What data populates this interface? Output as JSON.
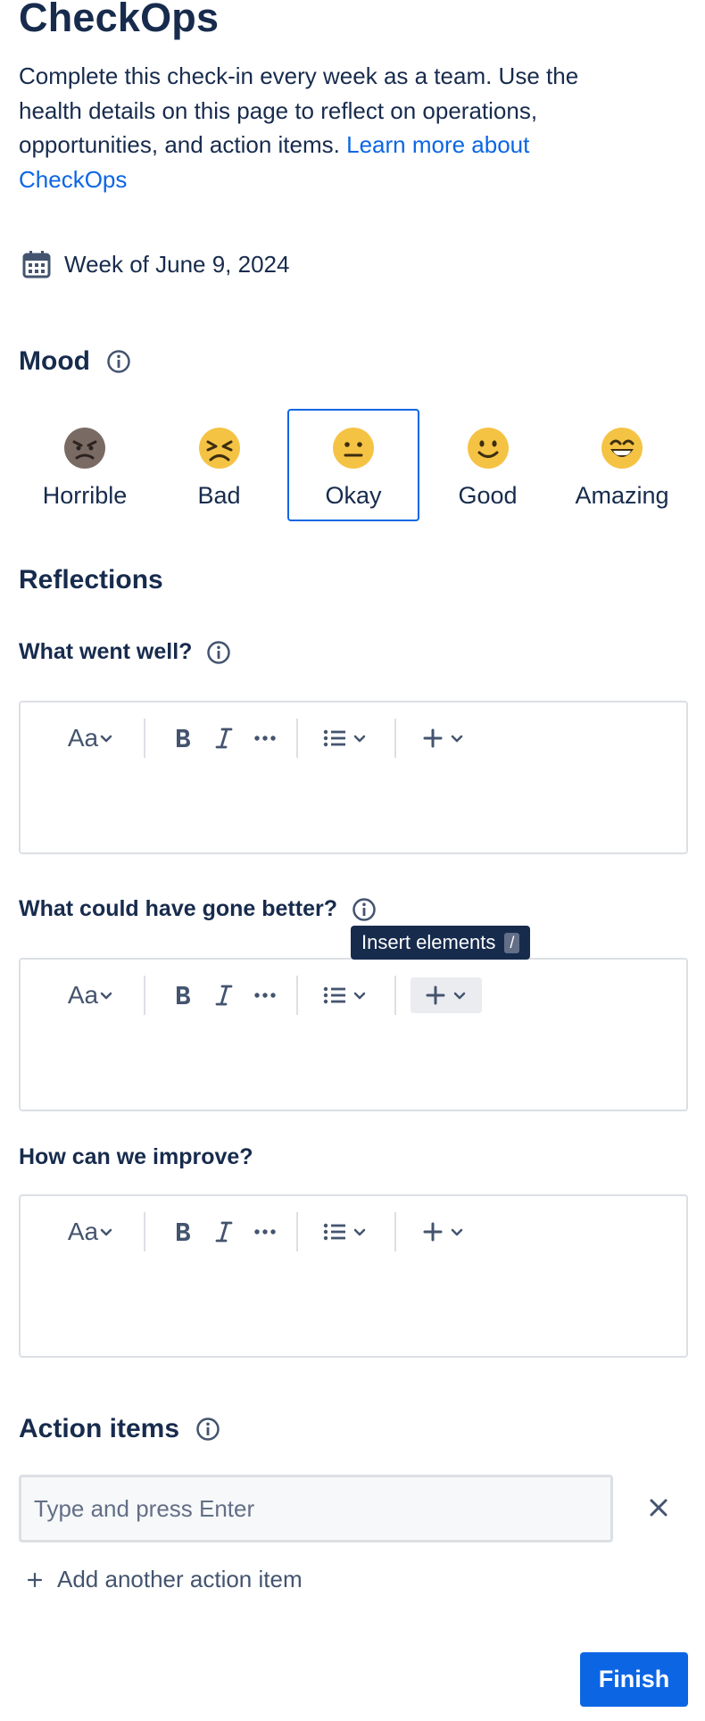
{
  "page": {
    "title": "CheckOps",
    "intro_text": "Complete this check-in every week as a team. Use the health details on this page to reflect on operations, opportunities, and action items.",
    "intro_link": "Learn more about CheckOps",
    "week_label": "Week of June 9, 2024"
  },
  "mood": {
    "heading": "Mood",
    "selected": "Okay",
    "options": [
      {
        "label": "Horrible",
        "icon": "angry-face-icon",
        "color": "#7a6a64"
      },
      {
        "label": "Bad",
        "icon": "tired-face-icon",
        "color": "#f5c344"
      },
      {
        "label": "Okay",
        "icon": "neutral-face-icon",
        "color": "#f5c344"
      },
      {
        "label": "Good",
        "icon": "smiling-face-icon",
        "color": "#f5c344"
      },
      {
        "label": "Amazing",
        "icon": "grinning-face-icon",
        "color": "#f5c344"
      }
    ]
  },
  "reflections": {
    "heading": "Reflections",
    "questions": [
      {
        "label": "What went well?",
        "has_info": true
      },
      {
        "label": "What could have gone better?",
        "has_info": true
      },
      {
        "label": "How can we improve?",
        "has_info": false
      }
    ],
    "toolbar": {
      "text_style": "Aa",
      "icons": [
        "text-style-icon",
        "bold-icon",
        "italic-icon",
        "more-formatting-icon",
        "bullet-list-icon",
        "insert-icon"
      ]
    },
    "tooltip": {
      "text": "Insert elements",
      "shortcut": "/"
    }
  },
  "action_items": {
    "heading": "Action items",
    "placeholder": "Type and press Enter",
    "value": "",
    "add_label": "Add another action item"
  },
  "footer": {
    "finish_label": "Finish"
  },
  "colors": {
    "primary": "#0c66e4",
    "text": "#172b4d",
    "subtle": "#44546f",
    "border": "#dcdfe4",
    "tooltip_bg": "#172b4d"
  }
}
